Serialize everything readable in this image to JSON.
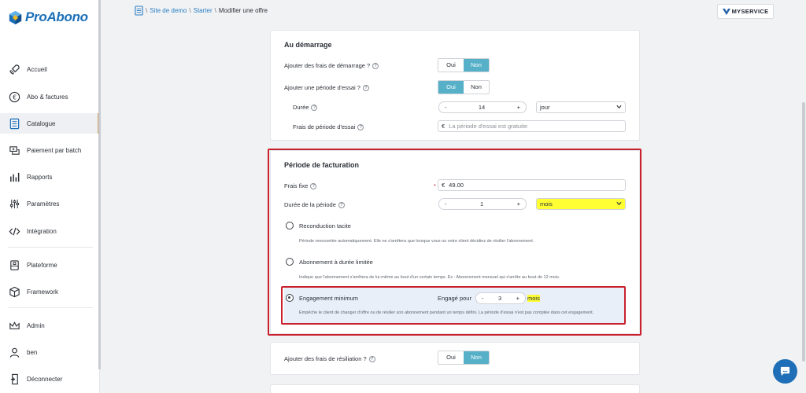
{
  "brand": {
    "name": "ProAbono"
  },
  "sidebar": {
    "items": [
      {
        "label": "Accueil"
      },
      {
        "label": "Abo & factures"
      },
      {
        "label": "Catalogue"
      },
      {
        "label": "Paiement par batch"
      },
      {
        "label": "Rapports"
      },
      {
        "label": "Paramètres"
      },
      {
        "label": "Intégration"
      },
      {
        "label": "Plateforme"
      },
      {
        "label": "Framework"
      },
      {
        "label": "Admin"
      },
      {
        "label": "ben"
      },
      {
        "label": "Déconnecter"
      }
    ]
  },
  "breadcrumb": {
    "sep": "\\",
    "items": [
      "Site de demo",
      "Starter"
    ],
    "current": "Modifier une offre"
  },
  "badge": {
    "text": "MYSERVICE"
  },
  "startup": {
    "title": "Au démarrage",
    "setup_fee_label": "Ajouter des frais de démarrage ?",
    "trial_label": "Ajouter une période d'essai ?",
    "yes": "Oui",
    "no": "Non",
    "duration_label": "Durée",
    "duration_value": "14",
    "duration_unit": "jour",
    "trial_fee_label": "Frais de période d'essai",
    "currency": "€",
    "trial_fee_placeholder": "La période d'essai est gratuite"
  },
  "billing": {
    "title": "Période de facturation",
    "fixed_fee_label": "Frais fixe",
    "required_mark": "*",
    "currency": "€",
    "fixed_fee_value": "49.00",
    "period_label": "Durée de la période",
    "period_value": "1",
    "period_unit": "mois",
    "options": [
      {
        "title": "Reconduction tacite",
        "desc": "Période renouvelée automatiquement. Elle ne s'arrêtera que lorsque vous ou votre client décidiez de résilier l'abonnement."
      },
      {
        "title": "Abonnement à durée limitée",
        "desc": "Indique que l'abonnement s'arrêtera de lui-même au bout d'un certain temps. Ex : Abonnement mensuel qui s'arrête au bout de 12 mois."
      },
      {
        "title": "Engagement minimum",
        "desc": "Empêche le client de changer d'offre ou de résilier son abonnement pendant un temps défini. La période d'essai n'est pas comptée dans cet engagement."
      }
    ],
    "commit_label": "Engagé pour",
    "commit_value": "3",
    "commit_unit": "mois"
  },
  "termination": {
    "label": "Ajouter des frais de résiliation ?",
    "yes": "Oui",
    "no": "Non"
  },
  "stepper": {
    "minus": "-",
    "plus": "+"
  },
  "colors": {
    "accent": "#56b0c8",
    "brand": "#1b6fb8",
    "highlight": "#ffff33",
    "frame": "#c8202c"
  }
}
